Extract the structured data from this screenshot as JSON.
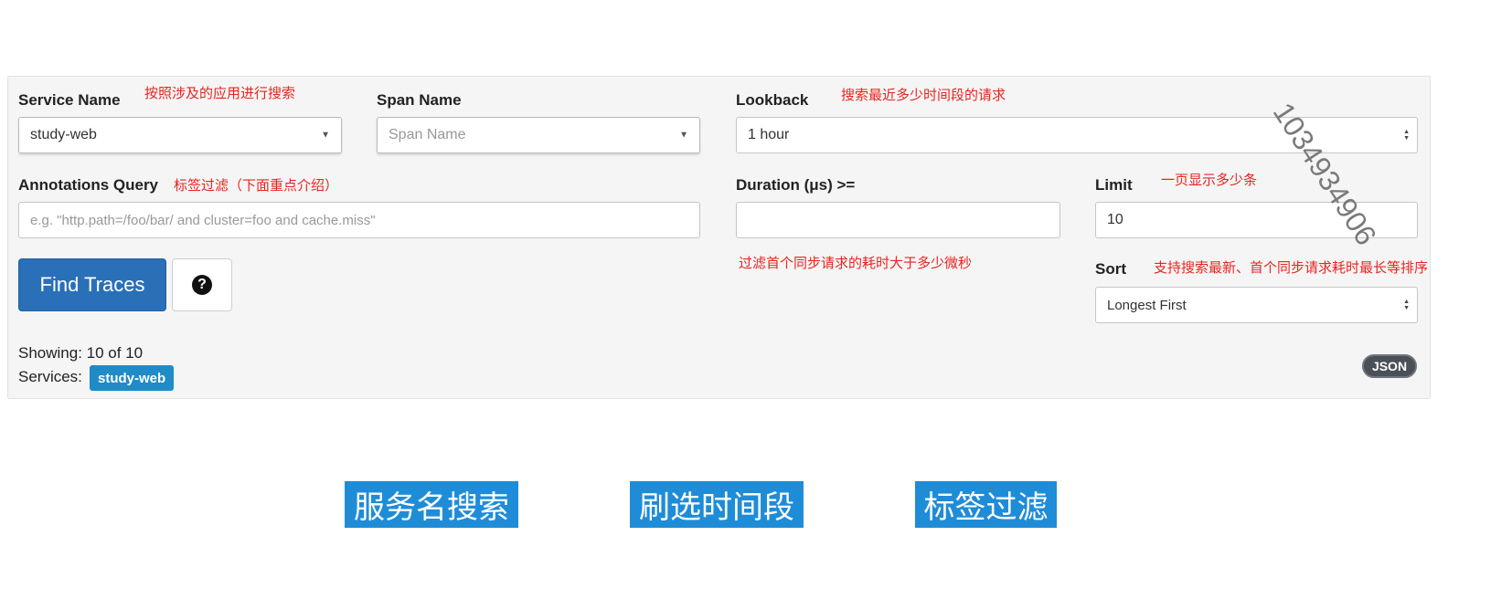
{
  "search_form": {
    "service_name": {
      "label": "Service Name",
      "note": "按照涉及的应用进行搜索",
      "value": "study-web"
    },
    "span_name": {
      "label": "Span Name",
      "placeholder": "Span Name"
    },
    "lookback": {
      "label": "Lookback",
      "note": "搜索最近多少时间段的请求",
      "value": "1 hour"
    },
    "annotations_query": {
      "label": "Annotations Query",
      "note": "标签过滤（下面重点介绍）",
      "placeholder": "e.g. \"http.path=/foo/bar/ and cluster=foo and cache.miss\""
    },
    "duration": {
      "label": "Duration (μs) >=",
      "note": "过滤首个同步请求的耗时大于多少微秒",
      "value": ""
    },
    "limit": {
      "label": "Limit",
      "note": "一页显示多少条",
      "value": "10"
    },
    "sort": {
      "label": "Sort",
      "note": "支持搜索最新、首个同步请求耗时最长等排序",
      "value": "Longest First"
    },
    "find_button": "Find Traces",
    "help_icon": "question-circle-icon",
    "help_glyph": "?"
  },
  "results": {
    "showing": "Showing: 10 of 10",
    "services_label": "Services:",
    "services": [
      "study-web"
    ],
    "json_button": "JSON"
  },
  "feature_tags": [
    "服务名搜索",
    "刷选时间段",
    "标签过滤"
  ],
  "watermark": "1034934906",
  "colors": {
    "primary_button": "#2a70b8",
    "service_badge": "#1f8bc7",
    "annotation_text": "#e8251f",
    "feature_tag": "#1f8cd8",
    "json_badge": "#4b4f57"
  }
}
